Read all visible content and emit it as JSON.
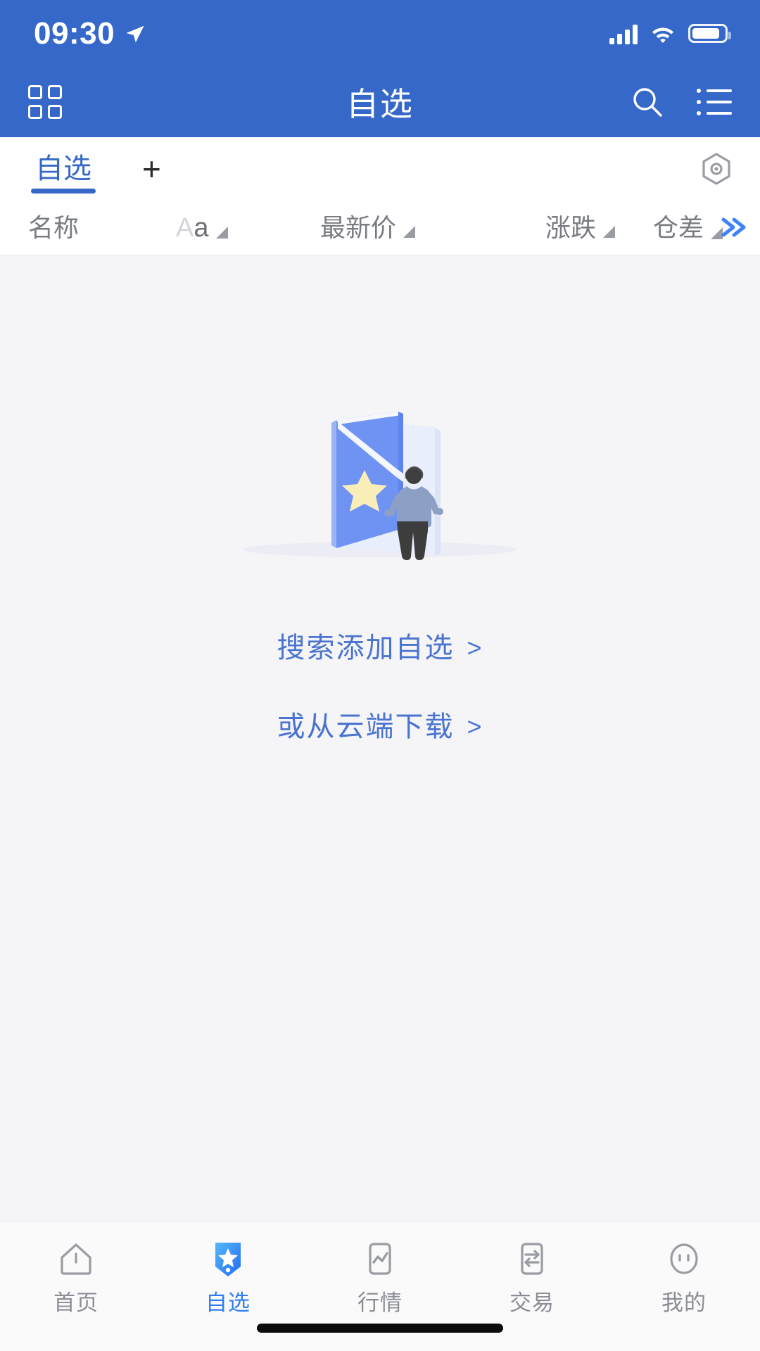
{
  "status_bar": {
    "time": "09:30",
    "location_icon": "location-arrow-icon",
    "signal_icon": "cellular-signal-icon",
    "wifi_icon": "wifi-icon",
    "battery_icon": "battery-full-icon"
  },
  "header": {
    "title": "自选",
    "grid_icon": "grid-menu-icon",
    "search_icon": "search-icon",
    "list_icon": "list-icon",
    "background_color": "#3568c8"
  },
  "tabstrip": {
    "tabs": [
      {
        "label": "自选",
        "active": true
      }
    ],
    "add_label": "+",
    "eye_icon": "hexagon-eye-icon",
    "active_color": "#3568c8"
  },
  "columns": [
    {
      "label": "名称",
      "sort_icon": false
    },
    {
      "label": "Aa",
      "sort_icon": true
    },
    {
      "label": "最新价",
      "sort_icon": true
    },
    {
      "label": "涨跌",
      "sort_icon": true
    },
    {
      "label": "仓差",
      "sort_icon": true,
      "expand_icon": "double-chevron-right-icon"
    }
  ],
  "empty_state": {
    "illustration": "open-folder-with-star-and-person-illustration",
    "links": [
      {
        "label": "搜索添加自选",
        "chevron": ">"
      },
      {
        "label": "或从云端下载",
        "chevron": ">"
      }
    ],
    "link_color": "#4a74cf"
  },
  "bottom_nav": {
    "items": [
      {
        "label": "首页",
        "icon": "home-icon",
        "active": false
      },
      {
        "label": "自选",
        "icon": "bookmark-star-icon",
        "active": true
      },
      {
        "label": "行情",
        "icon": "market-chart-icon",
        "active": false
      },
      {
        "label": "交易",
        "icon": "trade-exchange-icon",
        "active": false
      },
      {
        "label": "我的",
        "icon": "profile-face-icon",
        "active": false
      }
    ],
    "active_color": "#2f7df6",
    "inactive_color": "#8b8d94"
  },
  "home_indicator": "home-indicator-bar"
}
